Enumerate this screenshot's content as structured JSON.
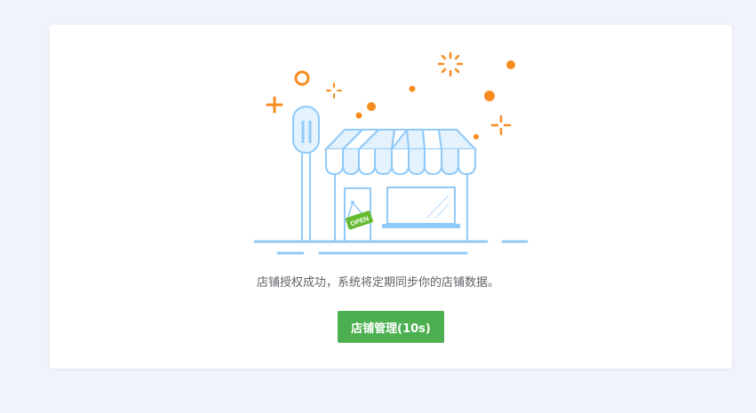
{
  "sign_text": "OPEN",
  "message": "店铺授权成功，系统将定期同步你的店铺数据。",
  "button_label": "店铺管理(10s)",
  "colors": {
    "background": "#f0f3fa",
    "card": "#ffffff",
    "accent_orange": "#f68b1f",
    "line_blue": "#90caf9",
    "fill_blue": "#e3f2fd",
    "sign_green": "#66bb33",
    "button_green": "#4caf50"
  }
}
